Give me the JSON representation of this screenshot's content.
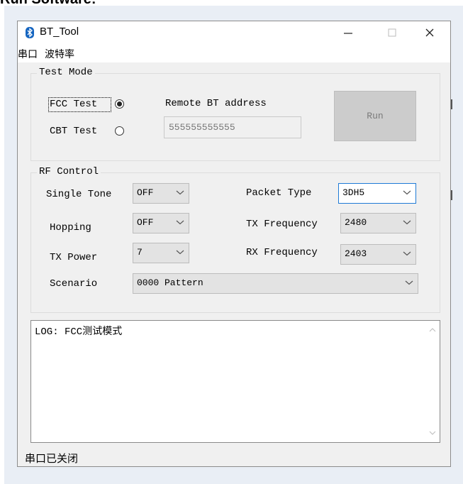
{
  "page_heading": "Run Software:",
  "window": {
    "title": "BT_Tool"
  },
  "menu": {
    "items": [
      "串口",
      "波特率"
    ]
  },
  "test_mode": {
    "group_title": "Test Mode",
    "fcc_label": "FCC Test",
    "cbt_label": "CBT Test",
    "selected": "FCC Test",
    "remote_label": "Remote BT address",
    "remote_address": "555555555555",
    "run_label": "Run"
  },
  "rf_control": {
    "group_title": "RF Control",
    "single_tone_label": "Single Tone",
    "single_tone_value": "OFF",
    "hopping_label": "Hopping",
    "hopping_value": "OFF",
    "tx_power_label": "TX Power",
    "tx_power_value": "7",
    "scenario_label": "Scenario",
    "scenario_value": "0000 Pattern",
    "packet_type_label": "Packet Type",
    "packet_type_value": "3DH5",
    "tx_freq_label": "TX Frequency",
    "tx_freq_value": "2480",
    "rx_freq_label": "RX Frequency",
    "rx_freq_value": "2403"
  },
  "log": {
    "text": "LOG: FCC测试模式"
  },
  "status": {
    "text": "串口已关闭"
  },
  "colors": {
    "accent_border": "#1e7ad6",
    "window_bg": "#f0f0f0",
    "run_disabled": "#cccccc"
  }
}
